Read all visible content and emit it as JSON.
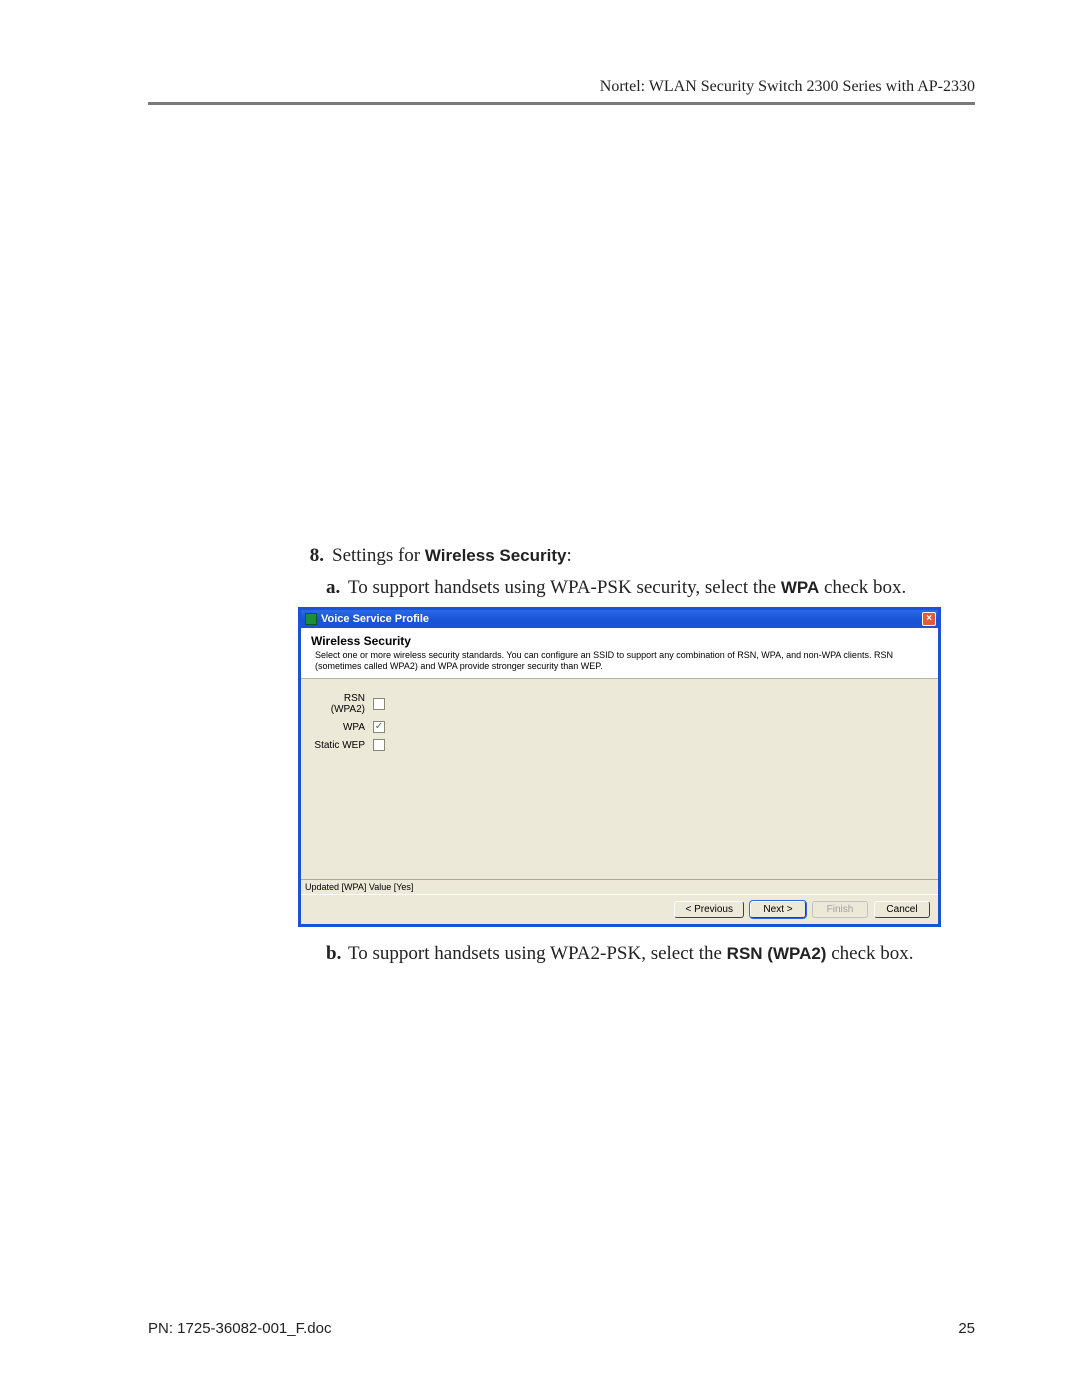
{
  "header": {
    "product": "Nortel: WLAN Security Switch 2300 Series with AP-2330"
  },
  "step": {
    "number": "8.",
    "text_pre": "Settings for ",
    "text_bold": "Wireless Security",
    "text_post": ":"
  },
  "sub_a": {
    "letter": "a.",
    "pre": "To support handsets using WPA-PSK security, select the ",
    "bold": "WPA",
    "post": " check box."
  },
  "sub_b": {
    "letter": "b.",
    "pre": "To support handsets using WPA2-PSK, select the ",
    "bold": "RSN (WPA2)",
    "post": " check box."
  },
  "dialog": {
    "title": "Voice Service Profile",
    "section_heading": "Wireless Security",
    "section_desc": "Select one or more wireless security standards. You can configure an SSID to support any combination of RSN, WPA, and non-WPA clients. RSN (sometimes called WPA2) and WPA provide stronger security than WEP.",
    "options": [
      {
        "label": "RSN (WPA2)",
        "checked": false
      },
      {
        "label": "WPA",
        "checked": true
      },
      {
        "label": "Static WEP",
        "checked": false
      }
    ],
    "status": "Updated [WPA] Value [Yes]",
    "buttons": {
      "prev": "< Previous",
      "next": "Next >",
      "finish": "Finish",
      "cancel": "Cancel"
    }
  },
  "footer": {
    "pn": "PN: 1725-36082-001_F.doc",
    "page": "25"
  }
}
